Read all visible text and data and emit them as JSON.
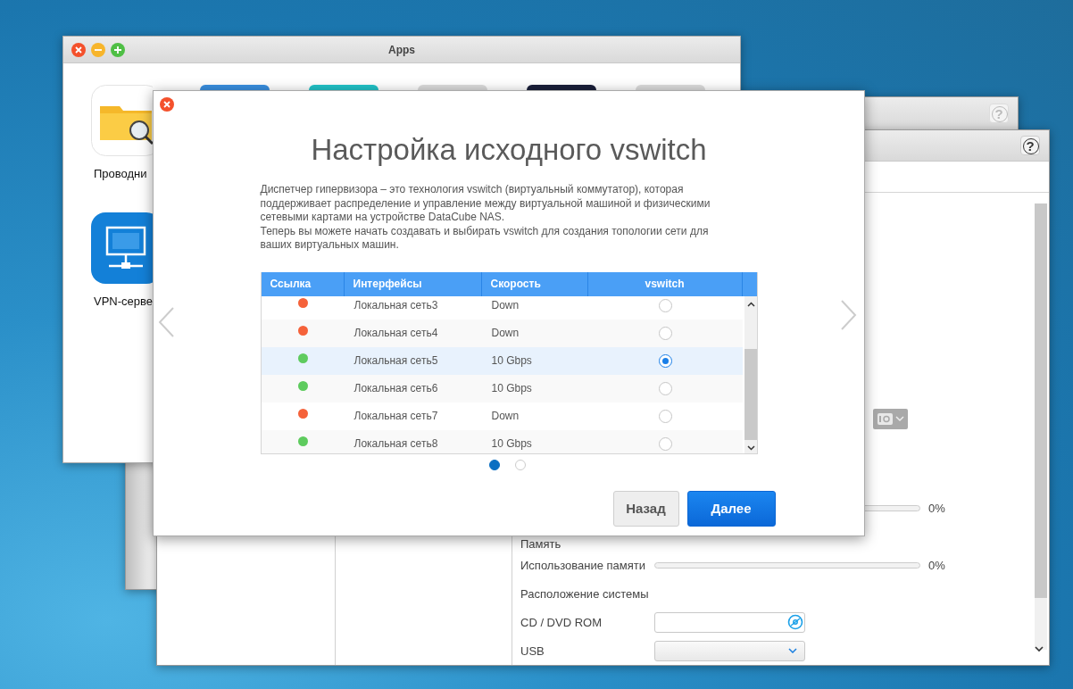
{
  "apps_window": {
    "title": "Apps",
    "apps": [
      {
        "kind": "explorer",
        "label": "Проводни"
      },
      {
        "kind": "tile",
        "color": "#3a8fe0"
      },
      {
        "kind": "tile",
        "color": "#22c3c8"
      },
      {
        "kind": "tile",
        "color": "#dcdcdc"
      },
      {
        "kind": "tile",
        "color": "#1a1f3a"
      },
      {
        "kind": "tile",
        "color": "#dcdcdc"
      },
      {
        "kind": "vpn",
        "label": "VPN-серве"
      }
    ]
  },
  "back_window": {
    "help": "?"
  },
  "vm_window": {
    "help": "?",
    "settings": [
      {
        "kind": "picker"
      },
      {
        "kind": "meter",
        "level": 0,
        "reading": "0%"
      },
      {
        "kind": "heading",
        "label": "Память"
      },
      {
        "kind": "meter",
        "label": "Использование памяти",
        "level": 0,
        "reading": "0%"
      },
      {
        "kind": "heading",
        "label": "Расположение системы"
      },
      {
        "kind": "file",
        "label": "CD / DVD ROM"
      },
      {
        "kind": "select",
        "label": "USB"
      }
    ]
  },
  "dialog": {
    "title": "Настройка исходного vswitch",
    "description": [
      "Диспетчер гипервизора – это технология vswitch (виртуальный коммутатор), которая поддерживает распределение и управление между виртуальной машиной и физическими сетевыми картами на устройстве DataCube NAS.",
      "Теперь вы можете начать создавать и выбирать vswitch для создания топологии сети для ваших виртуальных машин."
    ],
    "table": {
      "columns": [
        "Ссылка",
        "Интерфейсы",
        "Скорость",
        "vswitch"
      ],
      "rows": [
        {
          "color": "#f5623a",
          "interface": "Локальная сеть3",
          "speed": "Down",
          "selected": false
        },
        {
          "color": "#f5623a",
          "interface": "Локальная сеть4",
          "speed": "Down",
          "selected": false
        },
        {
          "color": "#5ecb5e",
          "interface": "Локальная сеть5",
          "speed": "10 Gbps",
          "selected": true
        },
        {
          "color": "#5ecb5e",
          "interface": "Локальная сеть6",
          "speed": "10 Gbps",
          "selected": false
        },
        {
          "color": "#f5623a",
          "interface": "Локальная сеть7",
          "speed": "Down",
          "selected": false
        },
        {
          "color": "#5ecb5e",
          "interface": "Локальная сеть8",
          "speed": "10 Gbps",
          "selected": false
        }
      ]
    },
    "pages": [
      {
        "selected": true
      },
      {
        "selected": false
      }
    ],
    "buttons": [
      {
        "kind": "secondary",
        "label": "Назад"
      },
      {
        "kind": "primary",
        "label": "Далее"
      }
    ]
  }
}
